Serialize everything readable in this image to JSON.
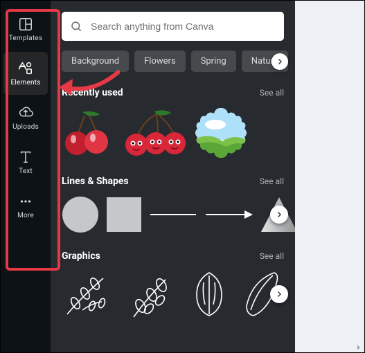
{
  "rail": {
    "items": [
      {
        "label": "Templates",
        "icon": "templates-icon"
      },
      {
        "label": "Elements",
        "icon": "elements-icon",
        "active": true
      },
      {
        "label": "Uploads",
        "icon": "uploads-icon"
      },
      {
        "label": "Text",
        "icon": "text-icon"
      },
      {
        "label": "More",
        "icon": "more-icon"
      }
    ]
  },
  "search": {
    "placeholder": "Search anything from Canva"
  },
  "chips": [
    "Background",
    "Flowers",
    "Spring",
    "Nature"
  ],
  "sections": {
    "recent": {
      "title": "Recently used",
      "see_all": "See all"
    },
    "shapes": {
      "title": "Lines & Shapes",
      "see_all": "See all"
    },
    "graphics": {
      "title": "Graphics",
      "see_all": "See all"
    }
  },
  "recent_items": [
    "cherries-pair",
    "cherries-face-trio",
    "scalloped-landscape-badge"
  ],
  "shape_items": [
    "circle",
    "square",
    "line",
    "arrow-line",
    "triangle"
  ],
  "graphics_items": [
    "branch-leaves-1",
    "branch-leaves-2",
    "leaf-outline",
    "surfboard-outline"
  ],
  "colors": {
    "accent_red": "#e63946",
    "panel_bg": "#272b30",
    "rail_bg": "#0d1216"
  }
}
